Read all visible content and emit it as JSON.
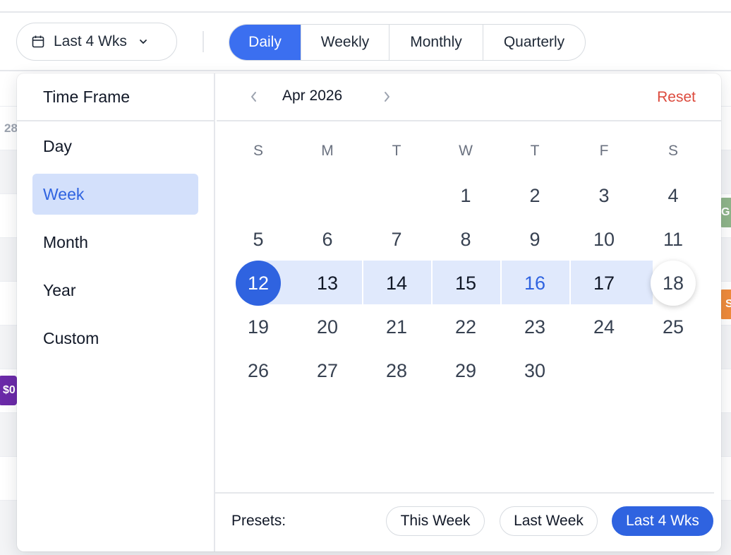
{
  "toolbar": {
    "range_button_label": "Last 4 Wks",
    "views": [
      {
        "label": "Daily",
        "active": true
      },
      {
        "label": "Weekly",
        "active": false
      },
      {
        "label": "Monthly",
        "active": false
      },
      {
        "label": "Quarterly",
        "active": false
      }
    ]
  },
  "background": {
    "peek_left": "28",
    "chip_right_1": "G",
    "chip_right_2": "S",
    "chip_left": "$0"
  },
  "time_frame": {
    "title": "Time Frame",
    "options": [
      {
        "label": "Day",
        "active": false
      },
      {
        "label": "Week",
        "active": true
      },
      {
        "label": "Month",
        "active": false
      },
      {
        "label": "Year",
        "active": false
      },
      {
        "label": "Custom",
        "active": false
      }
    ]
  },
  "calendar": {
    "month_label": "Apr 2026",
    "reset_label": "Reset",
    "weekdays": [
      "S",
      "M",
      "T",
      "W",
      "T",
      "F",
      "S"
    ],
    "weeks": [
      [
        "",
        "",
        "",
        "1",
        "2",
        "3",
        "4"
      ],
      [
        "5",
        "6",
        "7",
        "8",
        "9",
        "10",
        "11"
      ],
      [
        "12",
        "13",
        "14",
        "15",
        "16",
        "17",
        "18"
      ],
      [
        "19",
        "20",
        "21",
        "22",
        "23",
        "24",
        "25"
      ],
      [
        "26",
        "27",
        "28",
        "29",
        "30",
        "",
        ""
      ]
    ],
    "range_start": "12",
    "range_end": "18",
    "highlighted_day": "16"
  },
  "presets": {
    "label": "Presets:",
    "items": [
      {
        "label": "This Week",
        "active": false
      },
      {
        "label": "Last Week",
        "active": false
      },
      {
        "label": "Last 4 Wks",
        "active": true
      }
    ]
  },
  "colors": {
    "accent": "#2f63e0",
    "range_fill": "#e0e9fc",
    "reset": "#dc4a3d"
  }
}
